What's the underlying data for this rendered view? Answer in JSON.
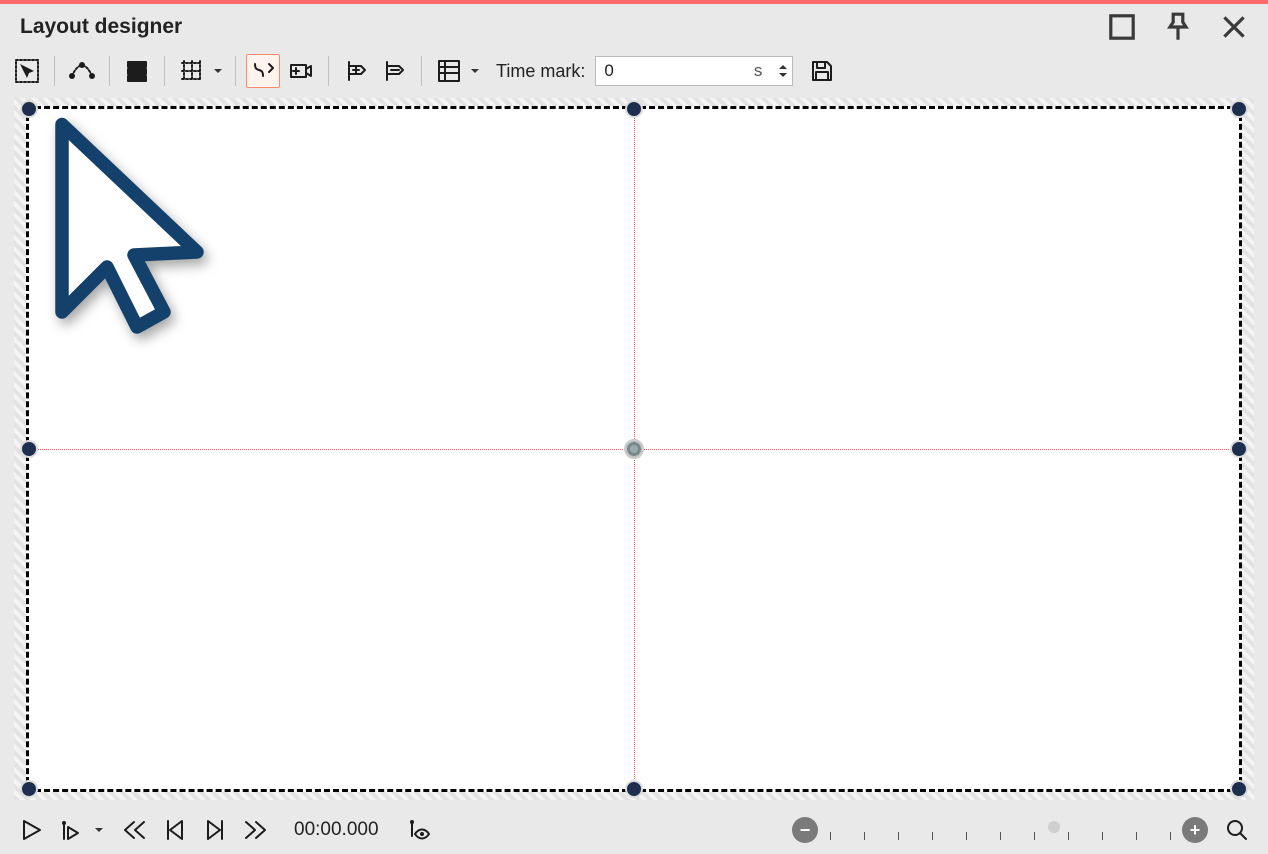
{
  "window": {
    "title": "Layout designer"
  },
  "toolbar": {
    "time_label": "Time mark:",
    "time_value": "0",
    "time_unit": "s",
    "icons": {
      "select": "select-dashed-icon",
      "curve": "curve-edit-icon",
      "stack": "layers-icon",
      "grid": "grid-icon",
      "path": "path-icon",
      "camera": "camera-add-icon",
      "key_add": "keyframe-add-icon",
      "key_remove": "keyframe-remove-icon",
      "table": "table-icon",
      "save": "save-icon"
    }
  },
  "bottombar": {
    "timecode": "00:00.000",
    "zoom_slider_pos": 0.64
  },
  "colors": {
    "accent": "#ff6b6b",
    "handle": "#1e2e4e",
    "guide": "#ff5a5a",
    "background": "#e9e9e9",
    "canvas": "#ffffff"
  }
}
